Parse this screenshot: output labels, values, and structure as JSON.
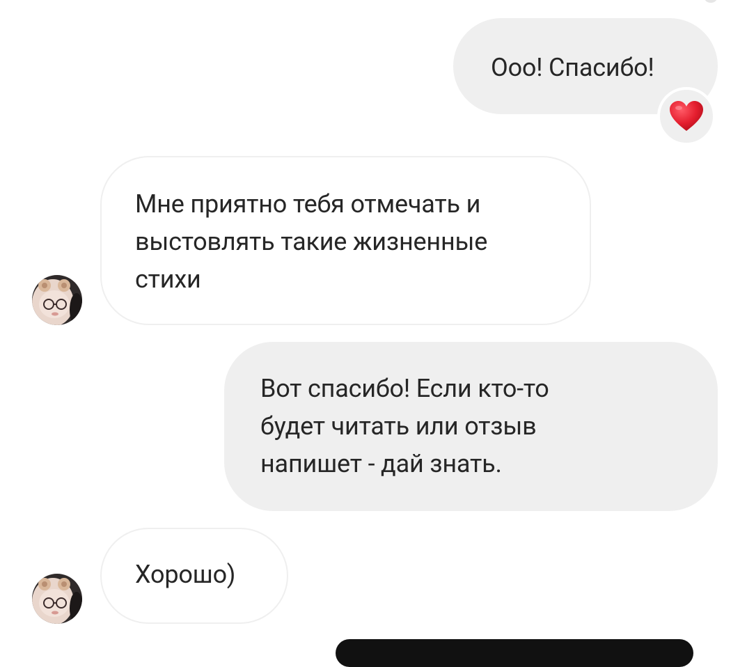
{
  "messages": [
    {
      "id": "m1",
      "direction": "outgoing",
      "text": "Ооо! Спасибо!",
      "reaction": "❤️"
    },
    {
      "id": "m2",
      "direction": "incoming",
      "lines": [
        "Мне приятно тебя отмечать и",
        "выстовлять такие жизненные",
        "стихи"
      ]
    },
    {
      "id": "m3",
      "direction": "outgoing",
      "lines": [
        "Вот спасибо! Если кто-то",
        "будет читать или отзыв",
        "напишет - дай знать."
      ]
    },
    {
      "id": "m4",
      "direction": "incoming",
      "text": "Хорошо)"
    }
  ],
  "icons": {
    "reaction": "heart-emoji",
    "avatar": "user-avatar-photo"
  },
  "colors": {
    "outgoing_bubble": "#efefef",
    "incoming_border": "#efefef",
    "text": "#262626",
    "heart": "#e0202f"
  }
}
